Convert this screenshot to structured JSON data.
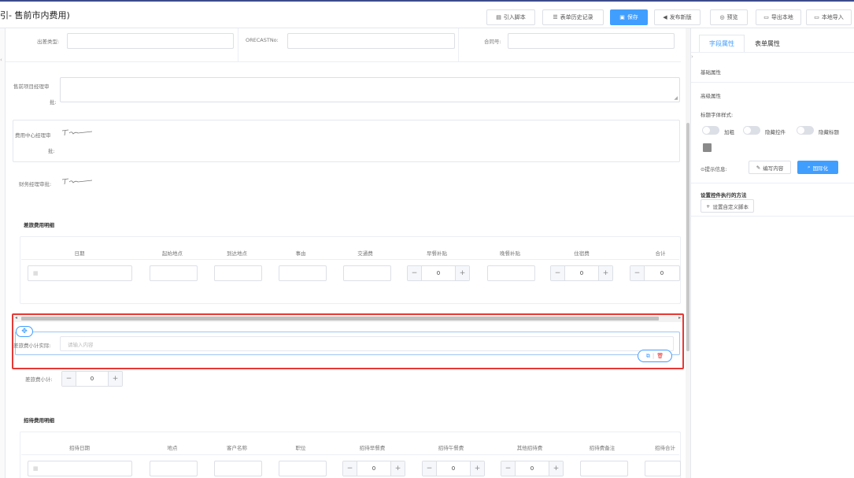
{
  "header": {
    "title": "引- 售前市内费用)",
    "buttons": {
      "import_script": "引入脚本",
      "history": "表单历史记录",
      "save": "保存",
      "publish": "发布新版",
      "preview": "预览",
      "export_local": "导出本地",
      "import_local": "本地导入"
    }
  },
  "form": {
    "row1": {
      "trip_type_label": "出差类型:",
      "forecast_label": "ORECASTNo:",
      "contract_label": "合同号:"
    },
    "presales_manager_label_1": "售前项目经理审",
    "presales_manager_label_2": "批:",
    "cost_center_label_1": "费用中心经理审",
    "cost_center_label_2": "批:",
    "finance_label": "财务经理审批:",
    "travel_section_title": "差旅费用明细",
    "travel_columns": [
      "日期",
      "起始地点",
      "到达地点",
      "事由",
      "交通费",
      "早餐补贴",
      "晚餐补贴",
      "住宿费",
      "合计"
    ],
    "stepper_value": "0",
    "actual_subtotal_label": "差旅费小计实际:",
    "actual_subtotal_placeholder": "请输入内容",
    "subtotal_label": "差旅费小计:",
    "entertain_section_title": "招待费用明细",
    "entertain_columns": [
      "招待日期",
      "地点",
      "客户名称",
      "职位",
      "招待早餐费",
      "招待午餐费",
      "其他招待费",
      "招待费备注",
      "招待合计"
    ]
  },
  "panel": {
    "tabs": [
      "字段属性",
      "表单属性"
    ],
    "basic": "基础属性",
    "advanced": "高级属性",
    "title_style_label": "标题字体样式:",
    "toggles": [
      "加粗",
      "隐藏控件",
      "隐藏标题"
    ],
    "hint_label": "⊙提示信息:",
    "edit_content": "编写内容",
    "i18n": "国际化",
    "method_title": "设置控件执行的方法",
    "custom_script": "设置自定义脚本"
  },
  "colors": {
    "primary": "#409eff",
    "selection": "#e53935",
    "header_border": "#3d4a8a"
  }
}
